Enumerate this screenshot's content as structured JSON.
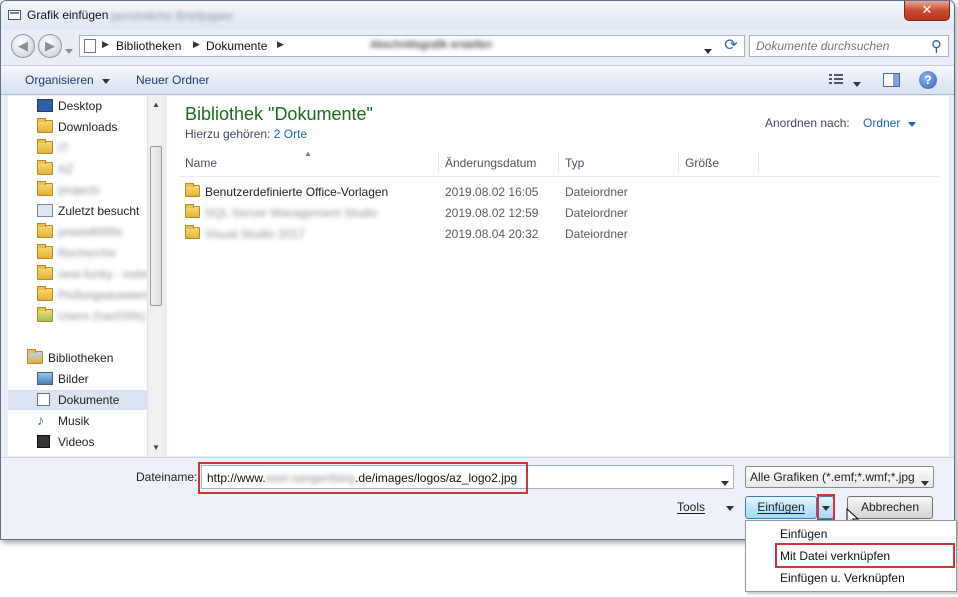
{
  "window": {
    "title": "Grafik einfügen",
    "title_ghost": "persönliche Briefpapier",
    "close_glyph": "✕"
  },
  "nav": {
    "back_glyph": "◀",
    "forward_glyph": "▶"
  },
  "address": {
    "segments": [
      "Bibliotheken",
      "Dokumente"
    ],
    "ghost_text": "Abschnittsgrafik erstellen",
    "refresh_glyph": "⟳"
  },
  "search": {
    "placeholder": "Dokumente durchsuchen",
    "icon_glyph": "⚲"
  },
  "toolbar": {
    "organize_label": "Organisieren",
    "new_folder_label": "Neuer Ordner",
    "help_glyph": "?"
  },
  "sidebar": {
    "items": [
      {
        "label": "Desktop",
        "icon": "desktop-icon"
      },
      {
        "label": "Downloads",
        "icon": "folder-icon"
      },
      {
        "label": "IT",
        "icon": "folder-icon",
        "blurred": true
      },
      {
        "label": "AZ",
        "icon": "folder-icon",
        "blurred": true
      },
      {
        "label": "projects",
        "icon": "folder-icon",
        "blurred": true
      },
      {
        "label": "Zuletzt besucht",
        "icon": "recent-places-icon"
      },
      {
        "label": "praxis6000s",
        "icon": "folder-icon",
        "blurred": true
      },
      {
        "label": "Recherche",
        "icon": "folder-icon",
        "blurred": true
      },
      {
        "label": "new-funky - external",
        "icon": "folder-icon",
        "blurred": true
      },
      {
        "label": "Prüfungsauswertung",
        "icon": "folder-icon",
        "blurred": true
      },
      {
        "label": "Users (\\\\az03\\fs)",
        "icon": "network-folder-icon",
        "blurred": true
      },
      {
        "label": "Bibliotheken",
        "icon": "libraries-icon"
      },
      {
        "label": "Bilder",
        "icon": "pictures-icon"
      },
      {
        "label": "Dokumente",
        "icon": "documents-icon",
        "selected": true
      },
      {
        "label": "Musik",
        "icon": "music-icon"
      },
      {
        "label": "Videos",
        "icon": "videos-icon"
      }
    ]
  },
  "main": {
    "title": "Bibliothek \"Dokumente\"",
    "subtitle_prefix": "Hierzu gehören:",
    "subtitle_link": "2 Orte",
    "sort_label": "Anordnen nach:",
    "sort_value": "Ordner",
    "columns": [
      "Name",
      "Änderungsdatum",
      "Typ",
      "Größe"
    ],
    "rows": [
      {
        "name": "Benutzerdefinierte Office-Vorlagen",
        "date": "2019.08.02 16:05",
        "type": "Dateiordner",
        "blurred": false
      },
      {
        "name": "SQL Server Management Studio",
        "date": "2019.08.02 12:59",
        "type": "Dateiordner",
        "blurred": true
      },
      {
        "name": "Visual Studio 2017",
        "date": "2019.08.04 20:32",
        "type": "Dateiordner",
        "blurred": true
      }
    ]
  },
  "footer": {
    "filename_label": "Dateiname:",
    "filename_prefix": "http://www.",
    "filename_hidden": "axel-sangenberg",
    "filename_suffix": ".de/images/logos/az_logo2.jpg",
    "filter_value": "Alle Grafiken (*.emf;*.wmf;*.jpg",
    "tools_label": "Tools",
    "insert_label": "Einfügen",
    "cancel_label": "Abbrechen"
  },
  "insert_menu": {
    "items": [
      "Einfügen",
      "Mit Datei verknüpfen",
      "Einfügen u. Verknüpfen"
    ],
    "highlighted_index": 1
  },
  "colors": {
    "highlight_outline": "#d3323c",
    "title_green": "#1b6b1b",
    "link_blue": "#1a5fb4"
  }
}
